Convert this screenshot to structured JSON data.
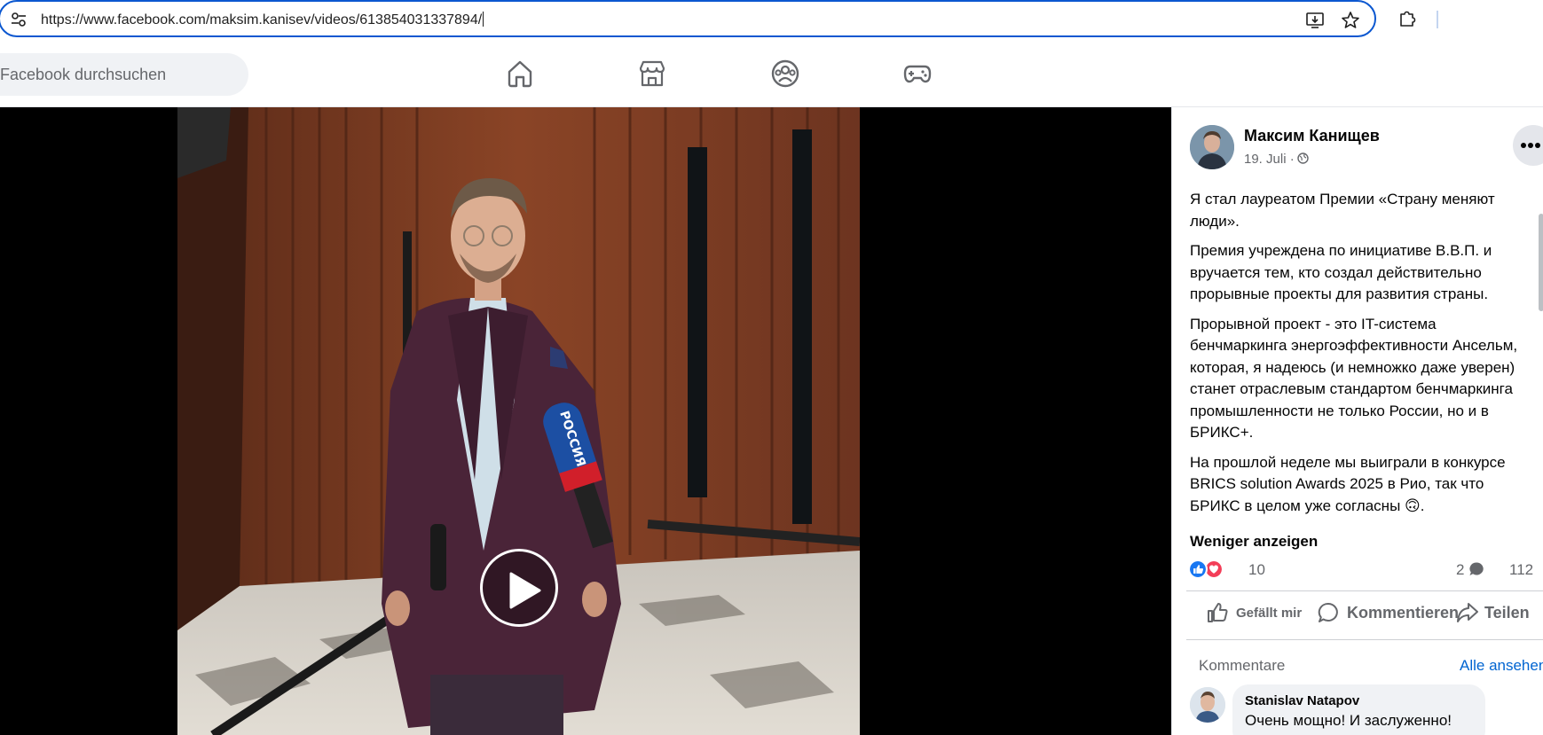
{
  "browser": {
    "url_prefix": "https://www.",
    "url_host": "facebook.com",
    "url_path": "/maksim.kanisev/videos/613854031337894/",
    "icons": [
      "tune-icon",
      "install-app-icon",
      "star-icon",
      "extensions-icon"
    ]
  },
  "fbnav": {
    "search_placeholder": "Facebook durchsuchen",
    "icons": [
      "home-icon",
      "marketplace-icon",
      "groups-icon",
      "gaming-icon"
    ]
  },
  "video": {
    "mic_label": "РОССИЯ",
    "play_icon": "play-icon"
  },
  "post": {
    "author": "Максим Канищев",
    "date": "19. Juli ·",
    "paragraphs": [
      "Я стал лауреатом Премии «Страну меняют люди».",
      "Премия учреждена по инициативе В.В.П. и вручается тем, кто создал действительно прорывные проекты для развития страны.",
      "Прорывной проект - это IT-система бенчмаркинга энергоэффективности Ансельм, которая, я надеюсь (и немножко даже уверен) станет отраслевым стандартом бенчмаркинга промышленности не только России, но и в БРИКС+.",
      "На прошлой неделе мы выиграли в конкурсе BRICS solution Awards 2025 в Рио, так что БРИКС в целом уже согласны 🙃."
    ],
    "show_less": "Weniger anzeigen",
    "reaction_count": "10",
    "comment_count": "2",
    "share_count": "112",
    "actions": {
      "like": "Gefällt mir",
      "comment": "Kommentieren",
      "share": "Teilen"
    }
  },
  "comments": {
    "label": "Kommentare",
    "all_label": "Alle ansehen",
    "items": [
      {
        "name": "Stanislav Natapov",
        "text": "Очень мощно! И заслуженно!"
      }
    ]
  },
  "colors": {
    "accent": "#0b57d0",
    "link": "#0064d1",
    "like_blue": "#1877f2",
    "love_red": "#f33e58"
  }
}
